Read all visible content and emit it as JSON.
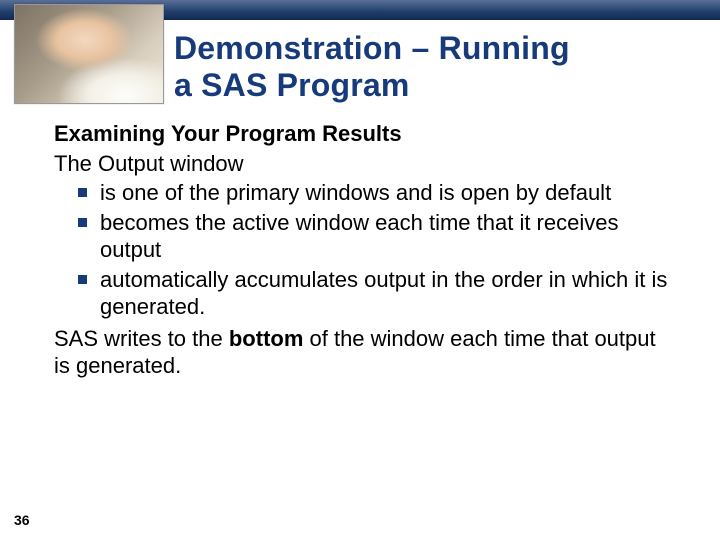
{
  "title_line1": "Demonstration – Running",
  "title_line2": "a SAS Program",
  "subhead": "Examining Your Program Results",
  "lead": "The Output window",
  "bullets": [
    "is one of the primary windows and is open by default",
    "becomes the active window each time that it receives output",
    "automatically accumulates output in the order in which it is generated."
  ],
  "closing_pre": "SAS writes to the ",
  "closing_bold": "bottom",
  "closing_post": " of the window each time that output is generated.",
  "page_number": "36"
}
